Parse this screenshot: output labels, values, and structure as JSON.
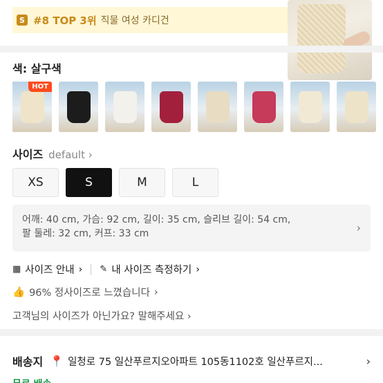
{
  "rank_banner": {
    "badge": "S",
    "highlight": "#8 TOP 3위",
    "desc": "직물 여성 카디건"
  },
  "color_section": {
    "label": "색: 살구색",
    "hot_label": "HOT",
    "swatches": [
      {
        "name": "apricot",
        "color": "#efe4c9"
      },
      {
        "name": "black",
        "color": "#1c1c1c"
      },
      {
        "name": "white-black-trim",
        "color": "#f3f1ec"
      },
      {
        "name": "wine",
        "color": "#a3203c"
      },
      {
        "name": "beige",
        "color": "#e8dcc3"
      },
      {
        "name": "rose",
        "color": "#c63a5a"
      },
      {
        "name": "cream",
        "color": "#f1e9d3"
      },
      {
        "name": "ivory",
        "color": "#ede3c8"
      }
    ]
  },
  "size_section": {
    "title": "사이즈",
    "default_label": "default",
    "chevron": "›",
    "options": [
      "XS",
      "S",
      "M",
      "L"
    ],
    "selected": "S",
    "measure_line1": "어깨: 40 cm, 가슴: 92 cm, 길이: 35 cm, 슬리브 길이: 54 cm,",
    "measure_line2": "팔 둘레: 32 cm, 커프: 33 cm",
    "guide_link": "사이즈 안내",
    "measure_link": "내 사이즈 측정하기",
    "fit_text": "96% 정사이즈로 느꼈습니다",
    "ask_text": "고객님의 사이즈가 아닌가요? 말해주세요"
  },
  "shipping": {
    "label": "배송지",
    "address": "일청로 75 일산푸르지오아파트 105동1102호 일산푸르지...",
    "delivery_peek": "무료 배송"
  }
}
